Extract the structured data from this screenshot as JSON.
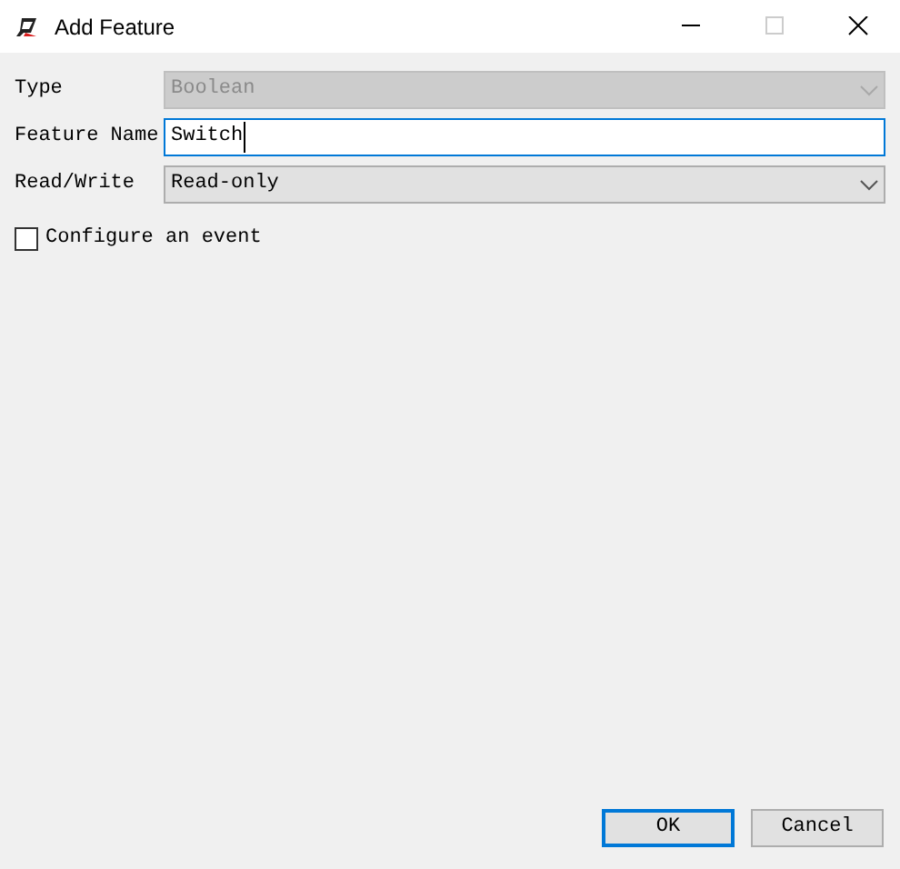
{
  "window": {
    "title": "Add Feature"
  },
  "fields": [
    {
      "kind": "dropdown",
      "label": "Type",
      "value": "Boolean",
      "disabled": true,
      "focused": false
    },
    {
      "kind": "text",
      "label": "Feature Name",
      "value": "Switch",
      "disabled": false,
      "focused": true
    },
    {
      "kind": "dropdown",
      "label": "Read/Write",
      "value": "Read-only",
      "disabled": false,
      "focused": false
    }
  ],
  "checkbox": {
    "label": "Configure an event",
    "checked": false
  },
  "buttons": [
    {
      "label": "OK",
      "default": true
    },
    {
      "label": "Cancel",
      "default": false
    }
  ]
}
